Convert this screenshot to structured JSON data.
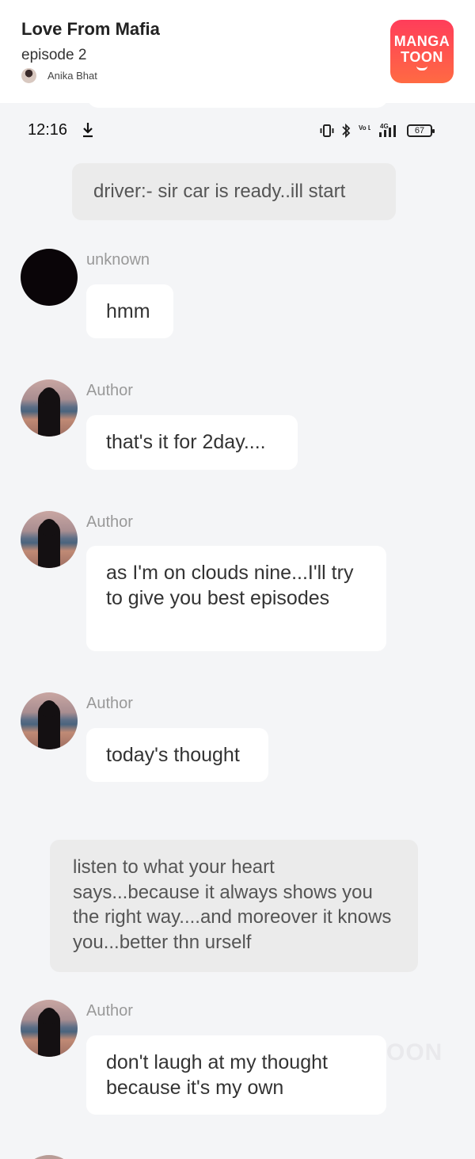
{
  "header": {
    "story_title": "Love From Mafia",
    "episode_title": "episode 2",
    "author_name": "Anika Bhat",
    "logo_line1": "MANGA",
    "logo_line2": "TOON"
  },
  "status_bar": {
    "time": "12:16",
    "battery": "67",
    "network": "4G",
    "volte": "Vo LTE"
  },
  "messages": [
    {
      "type": "narration",
      "text": "driver:- sir car is ready..ill start"
    },
    {
      "type": "speech",
      "speaker": "unknown",
      "text": "hmm",
      "avatar": "dark-avatar"
    },
    {
      "type": "speech",
      "speaker": "Author",
      "text": "that's it for 2day....",
      "avatar": "beach-silhouette-avatar"
    },
    {
      "type": "speech",
      "speaker": "Author",
      "text": "as I'm on clouds nine...I'll try to give you best episodes",
      "avatar": "beach-silhouette-avatar"
    },
    {
      "type": "speech",
      "speaker": "Author",
      "text": "today's thought",
      "avatar": "beach-silhouette-avatar"
    },
    {
      "type": "narration",
      "text": "listen to what your heart says...because it always shows you the right way....and moreover it knows you...better thn urself"
    },
    {
      "type": "speech",
      "speaker": "Author",
      "text": "don't laugh at my thought because it's my own",
      "avatar": "beach-silhouette-avatar"
    }
  ],
  "colors": {
    "background": "#f4f5f7",
    "bubble": "#ffffff",
    "narration_bubble": "#ebebeb",
    "speaker_label": "#999999",
    "logo_gradient_top": "#ff3d5a",
    "logo_gradient_bottom": "#ff6a43"
  },
  "watermark": "OON"
}
